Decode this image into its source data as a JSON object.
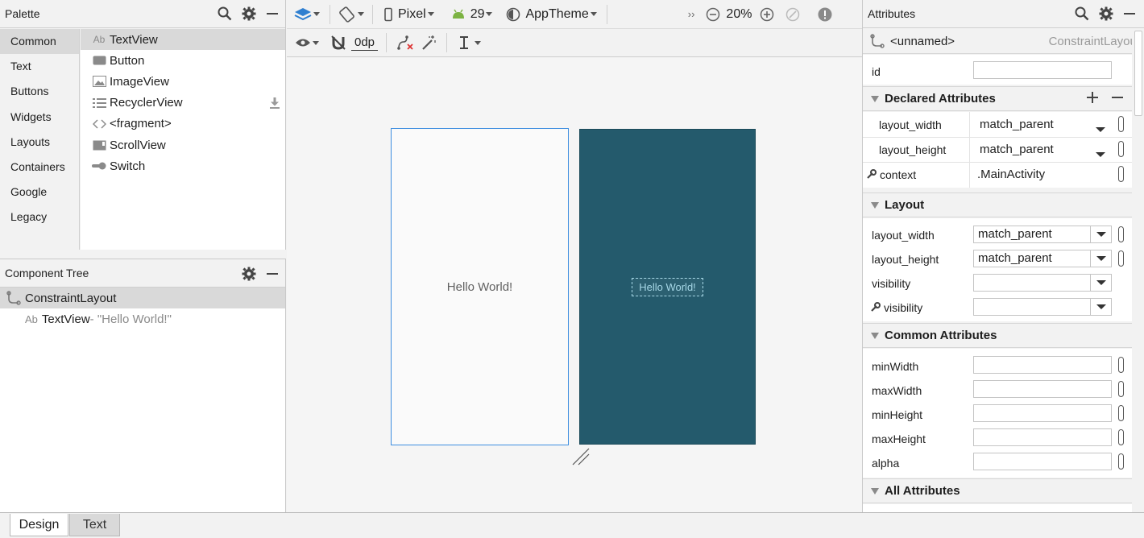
{
  "palette": {
    "title": "Palette",
    "categories": [
      "Common",
      "Text",
      "Buttons",
      "Widgets",
      "Layouts",
      "Containers",
      "Google",
      "Legacy"
    ],
    "selected_category": "Common",
    "items": [
      {
        "label": "TextView",
        "icon": "textview-icon"
      },
      {
        "label": "Button",
        "icon": "button-icon"
      },
      {
        "label": "ImageView",
        "icon": "imageview-icon"
      },
      {
        "label": "RecyclerView",
        "icon": "recyclerview-icon"
      },
      {
        "label": "<fragment>",
        "icon": "fragment-icon"
      },
      {
        "label": "ScrollView",
        "icon": "scrollview-icon"
      },
      {
        "label": "Switch",
        "icon": "switch-icon"
      }
    ],
    "icon_glyph_ab": "Ab"
  },
  "component_tree": {
    "title": "Component Tree",
    "root": "ConstraintLayout",
    "child_label": "TextView",
    "child_detail": "- \"Hello World!\""
  },
  "toolbar": {
    "device": "Pixel",
    "api_level": "29",
    "theme": "AppTheme",
    "zoom": "20%",
    "margin": "0dp",
    "overflow": "››"
  },
  "canvas": {
    "design_text": "Hello World!",
    "blueprint_text": "Hello World!"
  },
  "attributes": {
    "title": "Attributes",
    "component_name": "<unnamed>",
    "component_type": "ConstraintLayout",
    "id_label": "id",
    "id_value": "",
    "sections": {
      "declared": "Declared Attributes",
      "layout": "Layout",
      "common": "Common Attributes",
      "all": "All Attributes"
    },
    "declared": [
      {
        "name": "layout_width",
        "value": "match_parent"
      },
      {
        "name": "layout_height",
        "value": "match_parent"
      },
      {
        "name": "context",
        "value": ".MainActivity"
      }
    ],
    "layout": [
      {
        "name": "layout_width",
        "value": "match_parent"
      },
      {
        "name": "layout_height",
        "value": "match_parent"
      },
      {
        "name": "visibility",
        "value": ""
      },
      {
        "name": "visibility",
        "value": ""
      }
    ],
    "common": [
      {
        "name": "minWidth",
        "value": ""
      },
      {
        "name": "maxWidth",
        "value": ""
      },
      {
        "name": "minHeight",
        "value": ""
      },
      {
        "name": "maxHeight",
        "value": ""
      },
      {
        "name": "alpha",
        "value": ""
      }
    ]
  },
  "bottom_tabs": {
    "design": "Design",
    "text": "Text",
    "selected": "Design"
  },
  "colors": {
    "blueprint_bg": "#245a6c",
    "design_border": "#3e8ee0",
    "selection_bg": "#d9d9d9",
    "android_green": "#7cb342",
    "layers_blue": "#2f7fd0"
  }
}
